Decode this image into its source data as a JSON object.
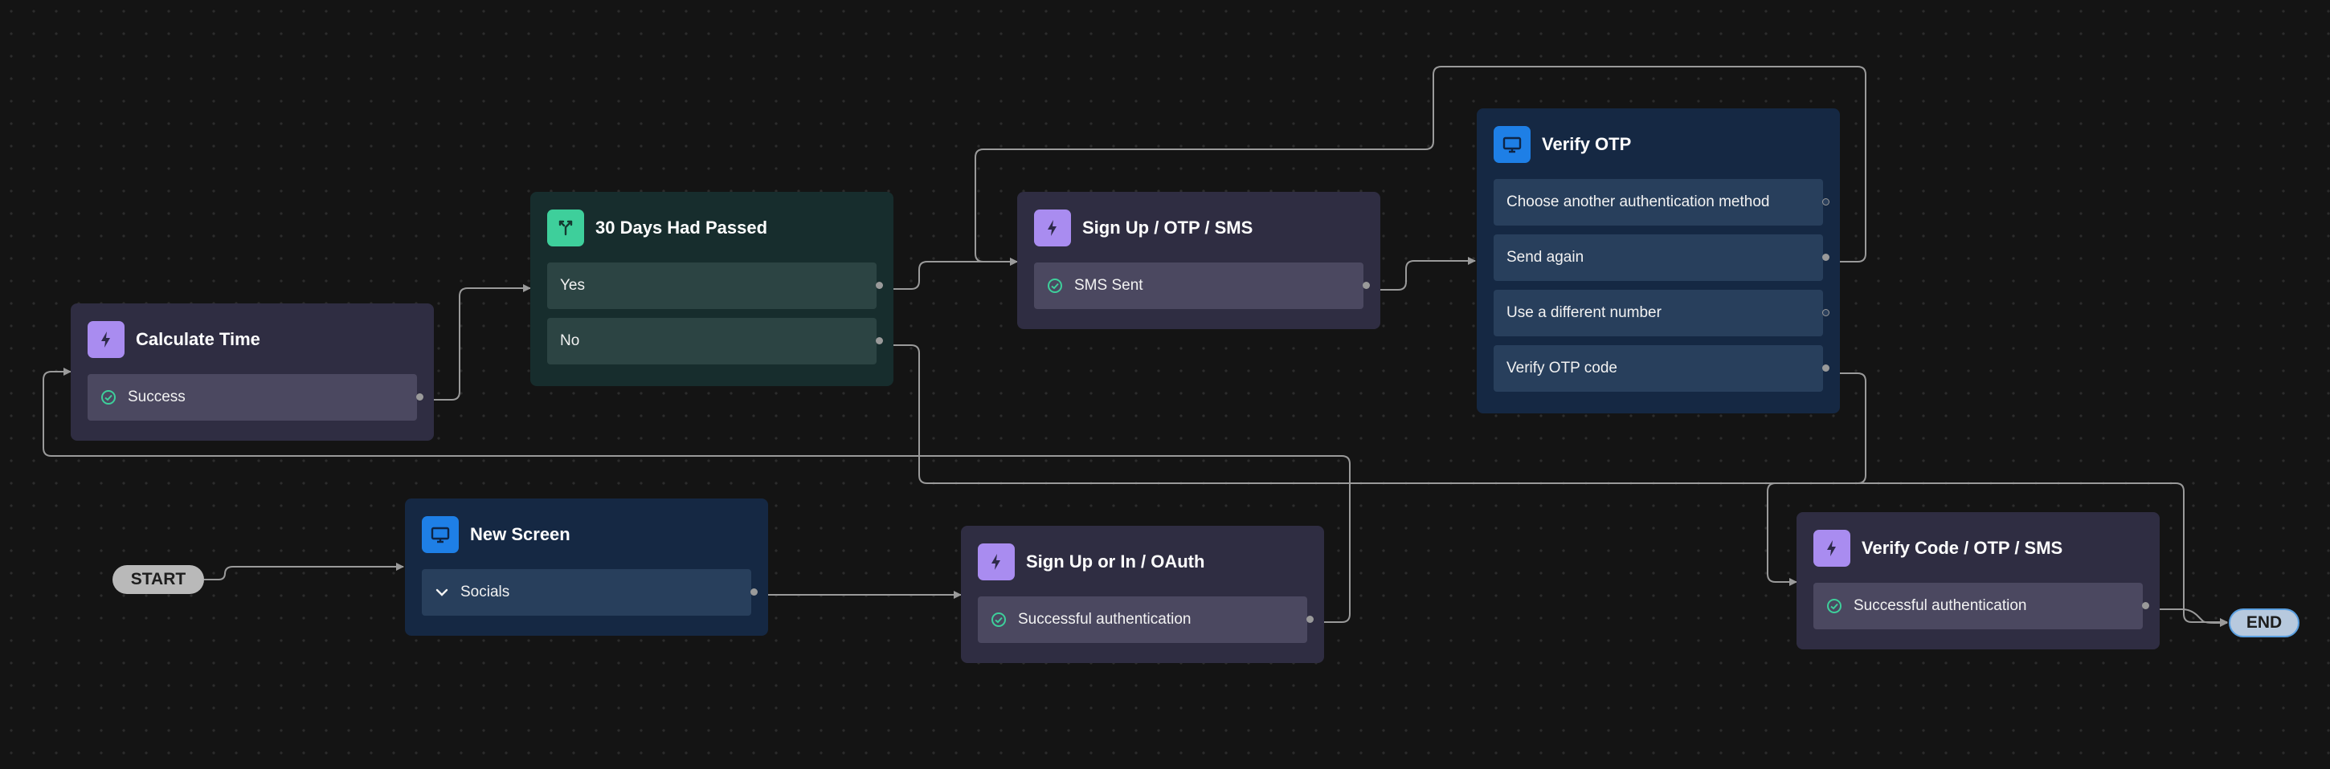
{
  "colors": {
    "background": "#141414",
    "edge": "#9a9a9a",
    "action_node": "#2f2d42",
    "screen_node": "#152843",
    "condition_node": "#172d2d",
    "action_icon": "#a98cf0",
    "screen_icon": "#1e7fe6",
    "condition_icon": "#3ecf9b",
    "success_check": "#3ecf9b"
  },
  "start": {
    "label": "START"
  },
  "end": {
    "label": "END"
  },
  "nodes": {
    "new_screen": {
      "type": "screen",
      "icon": "monitor-icon",
      "title": "New Screen",
      "rows": [
        {
          "label": "Socials",
          "icon": "chevron-down-icon"
        }
      ]
    },
    "signup_oauth": {
      "type": "action",
      "icon": "lightning-icon",
      "title": "Sign Up or In / OAuth",
      "rows": [
        {
          "label": "Successful authentication",
          "icon": "check-circle-icon"
        }
      ]
    },
    "calculate_time": {
      "type": "action",
      "icon": "lightning-icon",
      "title": "Calculate Time",
      "rows": [
        {
          "label": "Success",
          "icon": "check-circle-icon"
        }
      ]
    },
    "days_passed": {
      "type": "condition",
      "icon": "branch-icon",
      "title": "30 Days Had Passed",
      "rows": [
        {
          "label": "Yes"
        },
        {
          "label": "No"
        }
      ]
    },
    "signup_sms": {
      "type": "action",
      "icon": "lightning-icon",
      "title": "Sign Up / OTP / SMS",
      "rows": [
        {
          "label": "SMS Sent",
          "icon": "check-circle-icon"
        }
      ]
    },
    "verify_otp": {
      "type": "screen",
      "icon": "monitor-icon",
      "title": "Verify OTP",
      "rows": [
        {
          "label": "Choose another authentication method"
        },
        {
          "label": "Send again"
        },
        {
          "label": "Use a different number"
        },
        {
          "label": "Verify OTP code"
        }
      ]
    },
    "verify_code": {
      "type": "action",
      "icon": "lightning-icon",
      "title": "Verify Code / OTP / SMS",
      "rows": [
        {
          "label": "Successful authentication",
          "icon": "check-circle-icon"
        }
      ]
    }
  },
  "edges": [
    {
      "from": "start",
      "to": "new_screen"
    },
    {
      "from": "new_screen.socials",
      "to": "signup_oauth"
    },
    {
      "from": "signup_oauth.success",
      "to": "calculate_time"
    },
    {
      "from": "calculate_time.success",
      "to": "days_passed"
    },
    {
      "from": "days_passed.yes",
      "to": "signup_sms"
    },
    {
      "from": "days_passed.no",
      "to": "end"
    },
    {
      "from": "signup_sms.sms_sent",
      "to": "verify_otp"
    },
    {
      "from": "verify_otp.send_again",
      "to": "signup_sms"
    },
    {
      "from": "verify_otp.verify_code",
      "to": "verify_code"
    },
    {
      "from": "verify_code.success",
      "to": "end"
    }
  ]
}
